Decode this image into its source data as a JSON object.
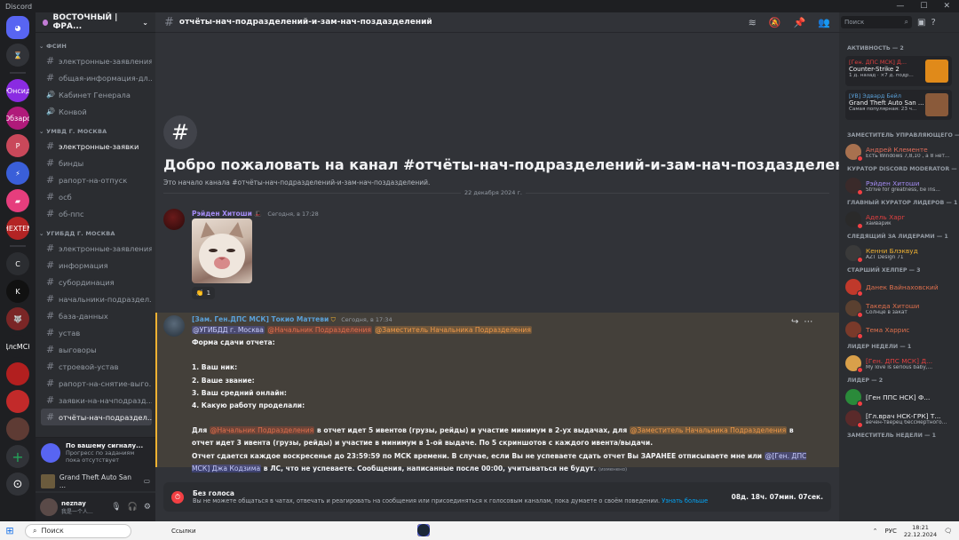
{
  "window": {
    "title": "Discord",
    "controls": [
      "—",
      "☐",
      "✕"
    ]
  },
  "guilds": [
    {
      "label": "",
      "color": "#5865f2",
      "icon": "discord-icon"
    },
    {
      "label": "",
      "color": "#313338",
      "icon": "hourglass-icon"
    },
    {
      "label": "Юнсид",
      "color": "#8a2be2"
    },
    {
      "label": "Обзаро",
      "color": "#b01a7a"
    },
    {
      "label": "P",
      "color": "#c9485a"
    },
    {
      "label": "",
      "color": "#3a5fd9",
      "icon": "bolt-icon"
    },
    {
      "label": "",
      "color": "#e63e7d",
      "icon": "folder-icon"
    },
    {
      "label": "HEXTEN",
      "color": "#b32424"
    },
    {
      "label": "C",
      "color": "#2b2d31"
    },
    {
      "label": "K",
      "color": "#111111"
    },
    {
      "label": "",
      "color": "#7a2626",
      "icon": "wolf-icon"
    },
    {
      "label": "ДлсМСК",
      "color": "#1e1f22"
    },
    {
      "label": "",
      "color": "#b21f1f"
    },
    {
      "label": "",
      "color": "#c22a2a"
    },
    {
      "label": "",
      "color": "#5e3b34"
    }
  ],
  "server": {
    "name": "ВОСТОЧНЫЙ | ФРА..."
  },
  "channel_list": [
    {
      "type": "cat",
      "label": "ФСИН"
    },
    {
      "type": "ch",
      "label": "электронные-заявления",
      "state": ""
    },
    {
      "type": "ch",
      "label": "общая-информация-дл...",
      "state": ""
    },
    {
      "type": "voice",
      "label": "Кабинет Генерала",
      "state": ""
    },
    {
      "type": "voice",
      "label": "Конвой",
      "state": ""
    },
    {
      "type": "cat",
      "label": "УМВД Г. МОСКВА"
    },
    {
      "type": "ch",
      "label": "электронные-заявки",
      "state": "unread"
    },
    {
      "type": "ch",
      "label": "бинды",
      "state": ""
    },
    {
      "type": "ch",
      "label": "рапорт-на-отпуск",
      "state": ""
    },
    {
      "type": "ch",
      "label": "осб",
      "state": ""
    },
    {
      "type": "ch",
      "label": "об-ппс",
      "state": ""
    },
    {
      "type": "cat",
      "label": "УГИБДД Г. МОСКВА"
    },
    {
      "type": "ch",
      "label": "электронные-заявления",
      "state": ""
    },
    {
      "type": "ch",
      "label": "информация",
      "state": ""
    },
    {
      "type": "ch",
      "label": "субординация",
      "state": ""
    },
    {
      "type": "ch",
      "label": "начальники-подраздел...",
      "state": ""
    },
    {
      "type": "ch",
      "label": "база-данных",
      "state": ""
    },
    {
      "type": "ch",
      "label": "устав",
      "state": ""
    },
    {
      "type": "ch",
      "label": "выговоры",
      "state": ""
    },
    {
      "type": "ch",
      "label": "строевой-устав",
      "state": ""
    },
    {
      "type": "ch",
      "label": "рапорт-на-снятие-выго...",
      "state": ""
    },
    {
      "type": "ch",
      "label": "заявки-на-начподразд...",
      "state": ""
    },
    {
      "type": "ch",
      "label": "отчёты-нач-подраздел...",
      "state": "active"
    }
  ],
  "voice_hint": {
    "title": "По вашему сигналу...",
    "subtitle": "Прогресс по заданиям пока отсутствует"
  },
  "game_activity": {
    "label": "Grand Theft Auto San ..."
  },
  "user": {
    "name": "neznay",
    "status": "我是一个人..."
  },
  "topbar": {
    "channel": "отчёты-нач-подразделений-и-зам-нач-поздазделений"
  },
  "welcome": {
    "title": "Добро пожаловать на канал #отчёты-нач-подразделений-и-зам-нач-поздазделений!",
    "subtitle": "Это начало канала #отчёты-нач-подразделений-и-зам-нач-поздазделений."
  },
  "day_separator": "22 декабря 2024 г.",
  "message1": {
    "author": "Рэйден Хитоши",
    "author_color": "#a58cf5",
    "time": "Сегодня, в 17:28",
    "reaction_count": "1"
  },
  "message2": {
    "author": "[Зам. Ген.ДПС МСК] Токио Маттеви",
    "author_color": "#5aa0d8",
    "time": "Сегодня, в 17:34",
    "mention_user": "@УГИБДД г. Москва",
    "mention_role1": "@Начальник Подразделения",
    "mention_role2": "@Заместитель Начальника Подразделения",
    "form_title": "Форма сдачи отчета:",
    "q1": "1. Ваш ник:",
    "q2": "2. Ваше звание:",
    "q3": "3. Ваш средний онлайн:",
    "q4": "4. Какую работу проделали:",
    "p1_a": "Для",
    "p1_role": "@Начальник Подразделения",
    "p1_b": "в отчет идет 5 ивентов (грузы, рейды) и участие минимум в 2-ух выдачах, для",
    "p1_role2": "@Заместитель Начальника Подразделения",
    "p1_c": "в отчет идет 3 ивента (грузы, рейды) и участие в минимум в 1-ой выдаче. По 5 скриншотов с каждого ивента/выдачи.",
    "p2_a": "Отчет сдается каждое воскресенье до 23:59:59 по МСК времени. В случае, если Вы не успеваете сдать отчет Вы ЗАРАНЕЕ отписываете мне или",
    "p2_mention": "@[Ген. ДПС МСК] Джа Кодзима",
    "p2_b": "в ЛС, что не успеваете. Сообщения, написанные после 00:00, учитываться не будут.",
    "edited": "(изменено)"
  },
  "mute_notice": {
    "title": "Без голоса",
    "text": "Вы не можете общаться в чатах, отвечать и реагировать на сообщения или присоединяться к голосовым каналам, пока думаете о своём поведении.",
    "link": "Узнать больше",
    "timer": "08д. 18ч. 07мин. 07сек."
  },
  "members": {
    "search_placeholder": "Поиск",
    "activity_header": "АКТИВНОСТЬ — 2",
    "activities": [
      {
        "name": "[Ген. ДПС МСК] Д...",
        "game": "Counter-Strike 2",
        "detail": "1 д. назад · ×7 д. подр...",
        "thumb": "#e08a1a"
      },
      {
        "name": "[УВ] Эдвард Бейл",
        "game": "Grand Theft Auto San ...",
        "detail": "Самая популярная: 23 ч...",
        "thumb": "#8a5a3a"
      }
    ],
    "groups": [
      {
        "header": "ЗАМЕСТИТЕЛЬ УПРАВЛЯЮЩЕГО — 1",
        "items": [
          {
            "name": "Андрей Клементе",
            "sub": "Есть Windows 7,8,10 , а 8 нет...",
            "color": "#e06c5a",
            "av": "#a8714f"
          }
        ]
      },
      {
        "header": "КУРАТОР DISCORD MODERATOR —",
        "items": [
          {
            "name": "Рэйден Хитоши",
            "sub": "Strive for greatness, be ins...",
            "color": "#a58cf5",
            "av": "#3a2a2a"
          }
        ]
      },
      {
        "header": "ГЛАВНЫЙ КУРАТОР ЛИДЕРОВ — 1",
        "items": [
          {
            "name": "Адель Харг",
            "sub": "хайварик",
            "color": "#e04040",
            "av": "#2a2a2a"
          }
        ]
      },
      {
        "header": "СЛЕДЯЩИЙ ЗА ЛИДЕРАМИ — 1",
        "items": [
          {
            "name": "Кенни Блэквуд",
            "sub": "AZT Design 71",
            "color": "#f0b232",
            "av": "#3a3a3a"
          }
        ]
      },
      {
        "header": "СТАРШИЙ ХЕЛПЕР — 3",
        "items": [
          {
            "name": "Данек Вайнаховский",
            "sub": "",
            "color": "#e0704d",
            "av": "#c0392b"
          },
          {
            "name": "Такеда Хитоши",
            "sub": "Солнце в закат",
            "color": "#e0704d",
            "av": "#5a4030"
          },
          {
            "name": "Тема Харрис",
            "sub": "",
            "color": "#e0704d",
            "av": "#7a3a2a"
          }
        ]
      },
      {
        "header": "ЛИДЕР НЕДЕЛИ — 1",
        "items": [
          {
            "name": "[Ген. ДПС МСК] Д...",
            "sub": "My love is serious baby,...",
            "color": "#e04040",
            "av": "#d9a04a"
          }
        ]
      },
      {
        "header": "ЛИДЕР — 2",
        "items": [
          {
            "name": "[Ген ППС НСК] Ф...",
            "sub": "",
            "color": "#f2f3f5",
            "av": "#2a8a3a"
          },
          {
            "name": "[Гл.врач НСК-ГРК] Т...",
            "sub": "вечен-тверец бессмертного...",
            "color": "#f2f3f5",
            "av": "#5a2a2a"
          }
        ]
      },
      {
        "header": "ЗАМЕСТИТЕЛЬ НЕДЕЛИ — 1",
        "items": []
      }
    ]
  },
  "taskbar": {
    "search": "Поиск",
    "links": "Ссылки",
    "lang": "РУС",
    "time": "18:21",
    "date": "22.12.2024"
  }
}
